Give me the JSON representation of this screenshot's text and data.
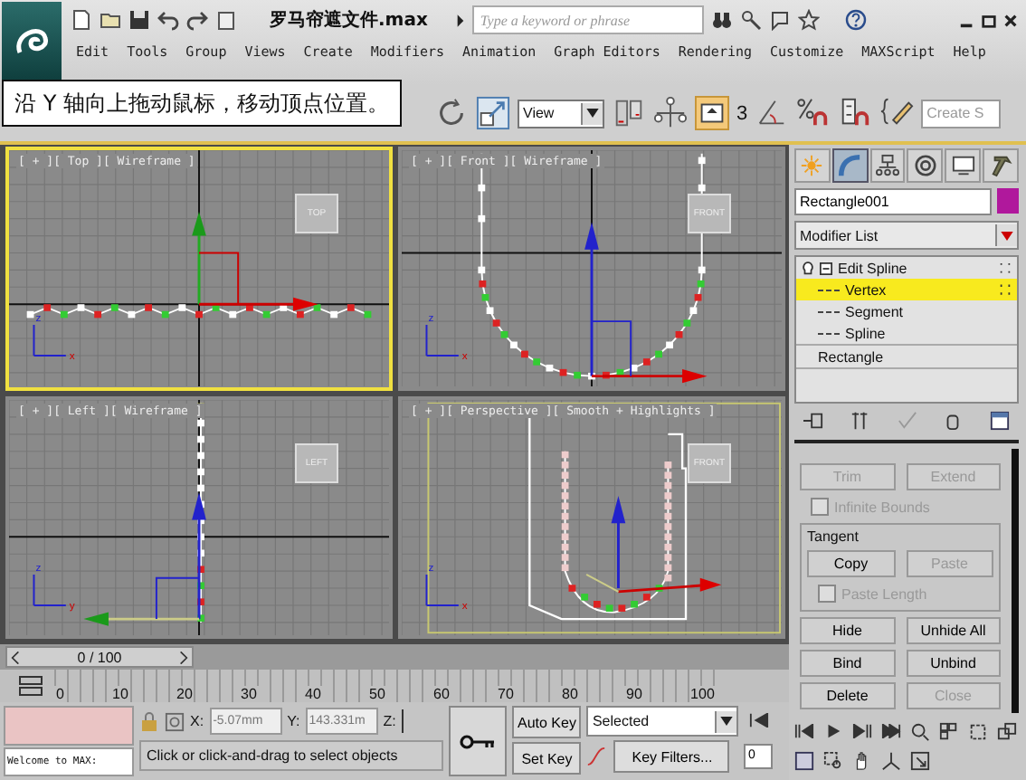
{
  "title_bar": {
    "file_title": "罗马帘遮文件.max",
    "search": {
      "placeholder": "Type a keyword or phrase"
    }
  },
  "menu": [
    "Edit",
    "Tools",
    "Group",
    "Views",
    "Create",
    "Modifiers",
    "Animation",
    "Graph Editors",
    "Rendering",
    "Customize",
    "MAXScript",
    "Help"
  ],
  "caption": "沿 Y 轴向上拖动鼠标，移动顶点位置。",
  "toolbar": {
    "reference_dropdown": "View",
    "snap_label": "3",
    "selection_set": {
      "placeholder": "Create S"
    }
  },
  "viewports": [
    {
      "kind": "top",
      "label": "[ + ][ Top ][ Wireframe ]",
      "cube": "TOP",
      "active": true,
      "tripod": [
        "z",
        "x"
      ]
    },
    {
      "kind": "front",
      "label": "[ + ][ Front ][ Wireframe ]",
      "cube": "FRONT",
      "active": false,
      "tripod": [
        "z",
        "x"
      ]
    },
    {
      "kind": "left",
      "label": "[ + ][ Left ][ Wireframe ]",
      "cube": "LEFT",
      "active": false,
      "tripod": [
        "z",
        "y"
      ]
    },
    {
      "kind": "perspective",
      "label": "[ + ][ Perspective ][ Smooth + Highlights ]",
      "cube": "FRONT",
      "active": false,
      "tripod": [
        "z",
        "x"
      ]
    }
  ],
  "command_panel": {
    "tabs": [
      {
        "kind": "create",
        "selected": false
      },
      {
        "kind": "modify",
        "selected": true
      },
      {
        "kind": "hierarchy",
        "selected": false
      },
      {
        "kind": "motion",
        "selected": false
      },
      {
        "kind": "display",
        "selected": false
      },
      {
        "kind": "utilities",
        "selected": false
      }
    ],
    "object_name": "Rectangle001",
    "modifier_list": "Modifier List",
    "stack": [
      {
        "label": "Edit Spline",
        "expanded": true,
        "selected": false,
        "children": [
          {
            "label": "Vertex",
            "selected": true
          },
          {
            "label": "Segment",
            "selected": false
          },
          {
            "label": "Spline",
            "selected": false
          }
        ]
      },
      {
        "label": "Rectangle",
        "selected": false
      }
    ],
    "rollout": [
      {
        "kind": "buttons",
        "items": [
          {
            "label": "Trim",
            "disabled": true
          },
          {
            "label": "Extend",
            "disabled": true
          }
        ]
      },
      {
        "kind": "checkbox",
        "label": "Infinite Bounds",
        "checked": false,
        "disabled": true
      },
      {
        "kind": "group",
        "title": "Tangent",
        "items": [
          {
            "kind": "buttons",
            "items": [
              {
                "label": "Copy",
                "disabled": false
              },
              {
                "label": "Paste",
                "disabled": true
              }
            ]
          },
          {
            "kind": "checkbox",
            "label": "Paste Length",
            "checked": false,
            "disabled": true
          }
        ]
      },
      {
        "kind": "buttons",
        "items": [
          {
            "label": "Hide",
            "disabled": false
          },
          {
            "label": "Unhide All",
            "disabled": false
          }
        ]
      },
      {
        "kind": "buttons",
        "items": [
          {
            "label": "Bind",
            "disabled": false
          },
          {
            "label": "Unbind",
            "disabled": false
          }
        ]
      },
      {
        "kind": "buttons",
        "items": [
          {
            "label": "Delete",
            "disabled": false
          },
          {
            "label": "Close",
            "disabled": true
          }
        ]
      }
    ]
  },
  "time_slider": {
    "label": "0 / 100",
    "level": 0
  },
  "track_ticks": [
    "0",
    "10",
    "20",
    "30",
    "40",
    "50",
    "60",
    "70",
    "80",
    "90",
    "100"
  ],
  "status": {
    "listener": "Welcome to MAX:",
    "x_label": "X:",
    "x_value": "-5.07mm",
    "y_label": "Y:",
    "y_value": "143.331m",
    "z_label": "Z:",
    "prompt": "Click or click-and-drag to select objects",
    "auto_key": "Auto Key",
    "set_key": "Set Key",
    "key_mode": "Selected",
    "key_filters": "Key Filters...",
    "frame": "0"
  }
}
